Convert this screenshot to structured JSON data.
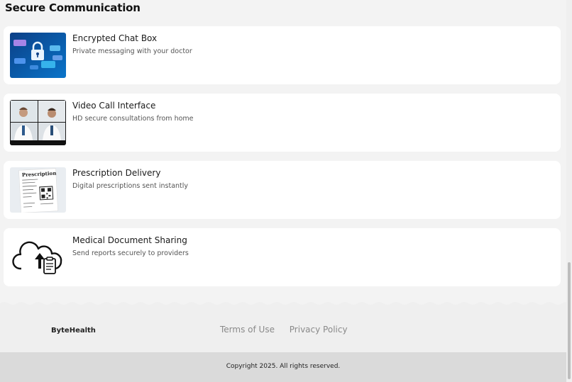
{
  "section": {
    "title": "Secure Communication"
  },
  "cards": [
    {
      "title": "Encrypted Chat Box",
      "description": "Private messaging with your doctor",
      "image": "encrypted-chat-image"
    },
    {
      "title": "Video Call Interface",
      "description": "HD secure consultations from home",
      "image": "video-call-image"
    },
    {
      "title": "Prescription Delivery",
      "description": "Digital prescriptions sent instantly",
      "image": "prescription-image"
    },
    {
      "title": "Medical Document Sharing",
      "description": "Send reports securely to providers",
      "image": "cloud-upload-document-icon"
    }
  ],
  "footer": {
    "brand": "ByteHealth",
    "links": [
      "Terms of Use",
      "Privacy Policy"
    ],
    "copyright": "Copyright 2025. All rights reserved."
  },
  "prescription_image_text": "Prescription"
}
